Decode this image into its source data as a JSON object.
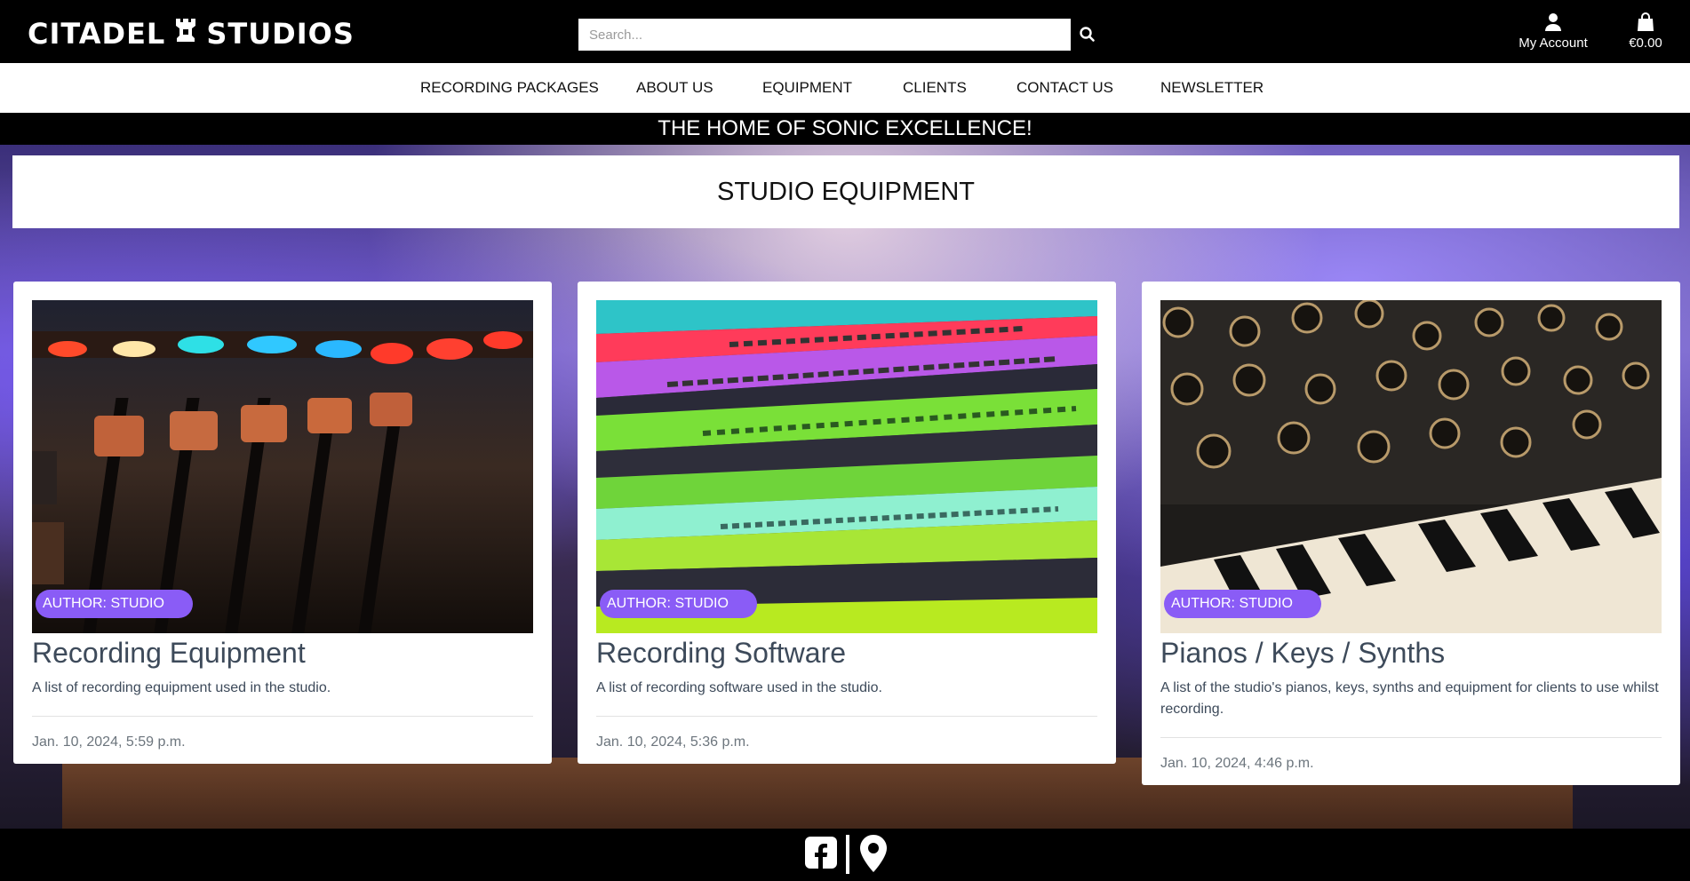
{
  "header": {
    "logo_left": "CITADEL",
    "logo_right": "STUDIOS",
    "search_placeholder": "Search...",
    "account_label": "My Account",
    "cart_total": "€0.00"
  },
  "nav": {
    "items": [
      {
        "label": "RECORDING PACKAGES"
      },
      {
        "label": "ABOUT US"
      },
      {
        "label": "EQUIPMENT"
      },
      {
        "label": "CLIENTS"
      },
      {
        "label": "CONTACT US"
      },
      {
        "label": "NEWSLETTER"
      }
    ]
  },
  "tagline": "THE HOME OF SONIC EXCELLENCE!",
  "page_title": "STUDIO EQUIPMENT",
  "cards": [
    {
      "badge": "AUTHOR: STUDIO",
      "title": "Recording Equipment",
      "description": "A list of recording equipment used in the studio.",
      "date": "Jan. 10, 2024, 5:59 p.m."
    },
    {
      "badge": "AUTHOR: STUDIO",
      "title": "Recording Software",
      "description": "A list of recording software used in the studio.",
      "date": "Jan. 10, 2024, 5:36 p.m."
    },
    {
      "badge": "AUTHOR: STUDIO",
      "title": "Pianos / Keys / Synths",
      "description": "A list of the studio's pianos, keys, synths and equipment for clients to use whilst recording.",
      "date": "Jan. 10, 2024, 4:46 p.m."
    }
  ],
  "colors": {
    "badge": "#8a5cf6",
    "header_bg": "#000000",
    "card_text": "#3d4a5a"
  },
  "icons": [
    "search-icon",
    "user-icon",
    "shopping-bag-icon",
    "facebook-icon",
    "map-pin-icon",
    "rook-tower-icon"
  ]
}
